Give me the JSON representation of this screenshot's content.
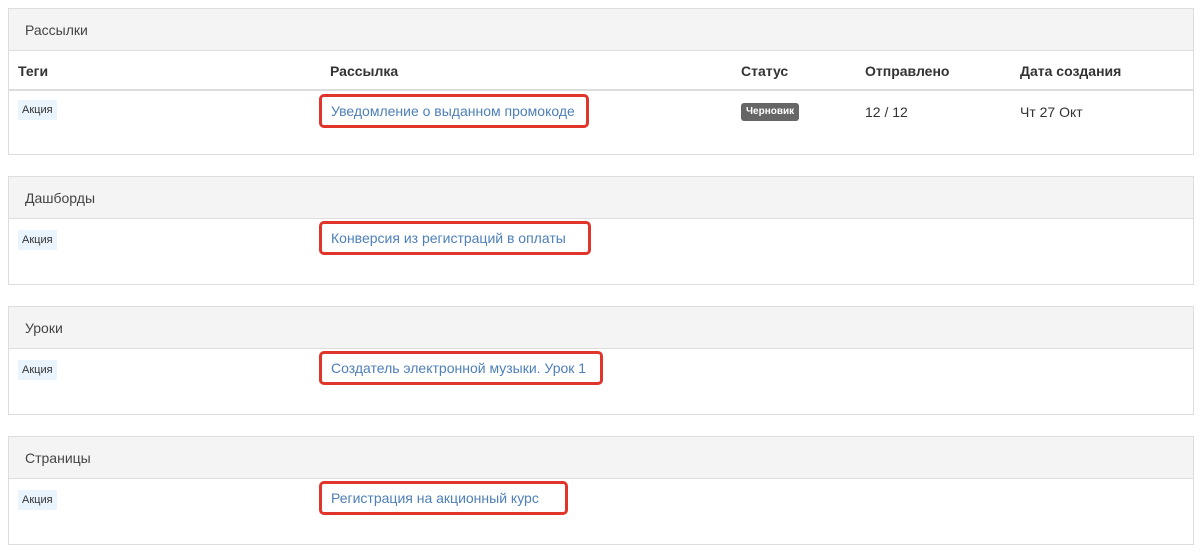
{
  "sections": [
    {
      "title": "Рассылки",
      "columns": {
        "tags": "Теги",
        "mailing": "Рассылка",
        "status": "Статус",
        "sent": "Отправлено",
        "created": "Дата создания"
      },
      "row": {
        "tag": "Акция",
        "link": "Уведомление о выданном промокоде",
        "status": "Черновик",
        "sent": "12 / 12",
        "created": "Чт 27 Окт"
      }
    },
    {
      "title": "Дашборды",
      "row": {
        "tag": "Акция",
        "link": "Конверсия из регистраций в оплаты"
      }
    },
    {
      "title": "Уроки",
      "row": {
        "tag": "Акция",
        "link": "Создатель электронной музыки. Урок 1"
      }
    },
    {
      "title": "Страницы",
      "row": {
        "tag": "Акция",
        "link": "Регистрация на акционный курс"
      }
    }
  ],
  "colors": {
    "highlight_border": "#e0352b",
    "link": "#4d7fb9",
    "tag_background": "#e9f4fc",
    "status_badge": "#666666",
    "heading_background": "#f4f4f4"
  }
}
